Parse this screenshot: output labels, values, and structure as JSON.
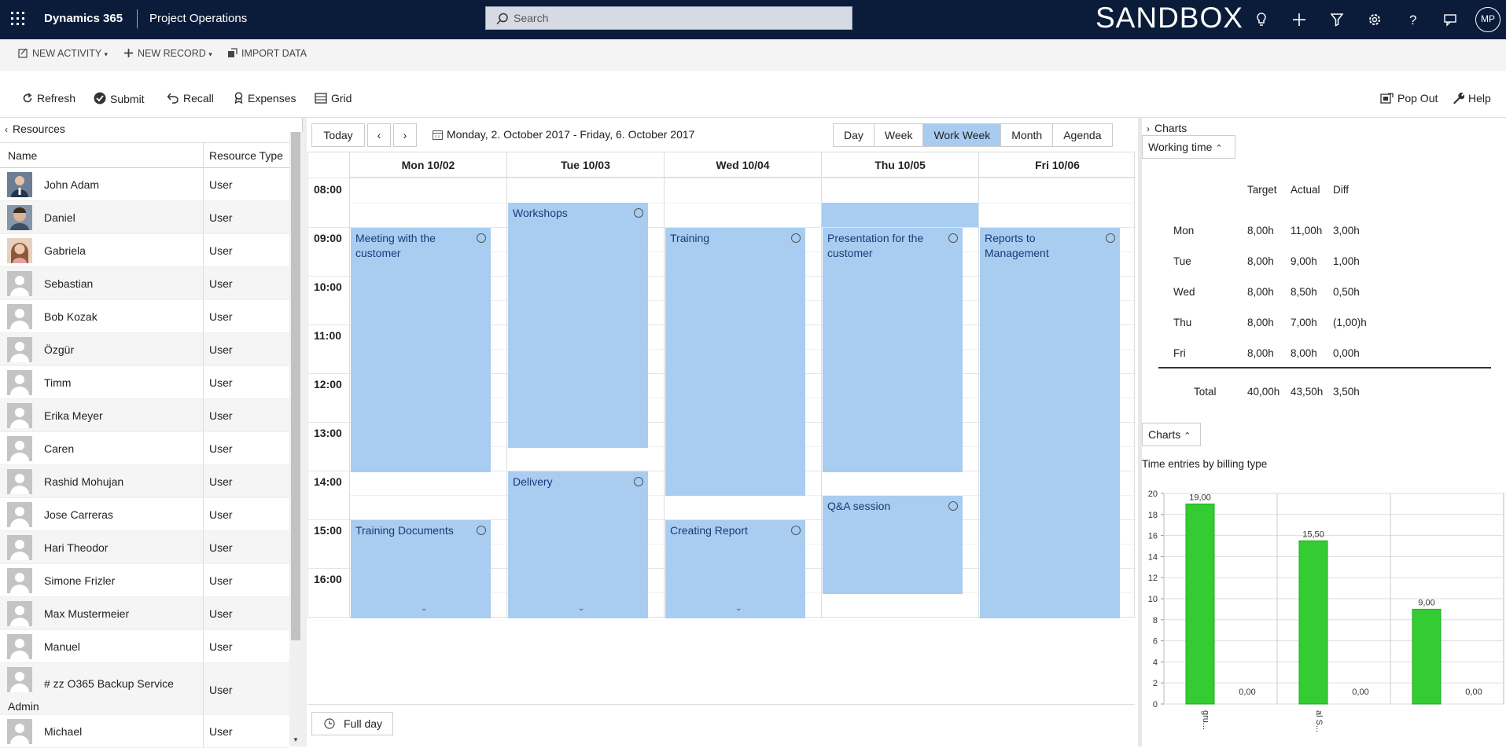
{
  "topbar": {
    "brand": "Dynamics 365",
    "app_name": "Project Operations",
    "search_placeholder": "Search",
    "environment_label": "SANDBOX",
    "user_initials": "MP"
  },
  "command_bar_1": {
    "new_activity": "NEW ACTIVITY",
    "new_record": "NEW RECORD",
    "import_data": "IMPORT DATA"
  },
  "command_bar_2": {
    "refresh": "Refresh",
    "submit": "Submit",
    "recall": "Recall",
    "expenses": "Expenses",
    "grid": "Grid",
    "pop_out": "Pop Out",
    "help": "Help"
  },
  "resources": {
    "title": "Resources",
    "col_name": "Name",
    "col_type": "Resource Type",
    "rows": [
      {
        "name": "John Adam",
        "type": "User"
      },
      {
        "name": "Daniel",
        "type": "User"
      },
      {
        "name": "Gabriela",
        "type": "User"
      },
      {
        "name": "Sebastian",
        "type": "User"
      },
      {
        "name": "Bob Kozak",
        "type": "User"
      },
      {
        "name": "Özgür",
        "type": "User"
      },
      {
        "name": "Timm",
        "type": "User"
      },
      {
        "name": "Erika Meyer",
        "type": "User"
      },
      {
        "name": "Caren",
        "type": "User"
      },
      {
        "name": "Rashid Mohujan",
        "type": "User"
      },
      {
        "name": "Jose Carreras",
        "type": "User"
      },
      {
        "name": "Hari Theodor",
        "type": "User"
      },
      {
        "name": "Simone Frizler",
        "type": "User"
      },
      {
        "name": "Max Mustermeier",
        "type": "User"
      },
      {
        "name": "Manuel",
        "type": "User"
      },
      {
        "name": "# zz O365 Backup Service Admin",
        "type": "User"
      },
      {
        "name": "Michael",
        "type": "User"
      }
    ]
  },
  "calendar": {
    "today": "Today",
    "date_range": "Monday, 2. October 2017 - Friday, 6. October 2017",
    "views": [
      "Day",
      "Week",
      "Work Week",
      "Month",
      "Agenda"
    ],
    "active_view": "Work Week",
    "days": [
      "Mon 10/02",
      "Tue 10/03",
      "Wed 10/04",
      "Thu 10/05",
      "Fri 10/06"
    ],
    "times": [
      "08:00",
      "09:00",
      "10:00",
      "11:00",
      "12:00",
      "13:00",
      "14:00",
      "15:00",
      "16:00"
    ],
    "events": [
      {
        "title": "Meeting with the customer"
      },
      {
        "title": "Training Documents"
      },
      {
        "title": "Workshops"
      },
      {
        "title": "Delivery"
      },
      {
        "title": "Training"
      },
      {
        "title": "Creating Report"
      },
      {
        "title": "Presentation for the customer"
      },
      {
        "title": "Q&A session"
      },
      {
        "title": "Reports to Management"
      }
    ],
    "full_day": "Full day"
  },
  "charts_panel": {
    "title": "Charts",
    "working_time_label": "Working time",
    "working_time": {
      "headers": [
        "Target",
        "Actual",
        "Diff"
      ],
      "rows": [
        {
          "day": "Mon",
          "target": "8,00h",
          "actual": "11,00h",
          "diff": "3,00h"
        },
        {
          "day": "Tue",
          "target": "8,00h",
          "actual": "9,00h",
          "diff": "1,00h"
        },
        {
          "day": "Wed",
          "target": "8,00h",
          "actual": "8,50h",
          "diff": "0,50h"
        },
        {
          "day": "Thu",
          "target": "8,00h",
          "actual": "7,00h",
          "diff": "(1,00)h"
        },
        {
          "day": "Fri",
          "target": "8,00h",
          "actual": "8,00h",
          "diff": "0,00h"
        }
      ],
      "total": {
        "label": "Total",
        "target": "40,00h",
        "actual": "43,50h",
        "diff": "3,50h"
      }
    },
    "charts_label": "Charts",
    "chart_title": "Time entries by billing type"
  },
  "chart_data": {
    "type": "bar",
    "title": "Time entries by billing type",
    "categories": [
      "gru...",
      "al S...",
      ""
    ],
    "series": [
      {
        "values": [
          19.0,
          15.5,
          9.0
        ]
      },
      {
        "values": [
          0.0,
          0.0,
          0.0
        ]
      }
    ],
    "data_labels": [
      [
        "19,00",
        "15,50",
        "9,00"
      ],
      [
        "0,00",
        "0,00",
        "0,00"
      ]
    ],
    "yticks": [
      "0",
      "2",
      "4",
      "6",
      "8",
      "10",
      "12",
      "14",
      "16",
      "18",
      "20"
    ],
    "ylim": [
      0,
      20
    ],
    "grid": true,
    "colors": {
      "bar": "#33cc33"
    }
  }
}
